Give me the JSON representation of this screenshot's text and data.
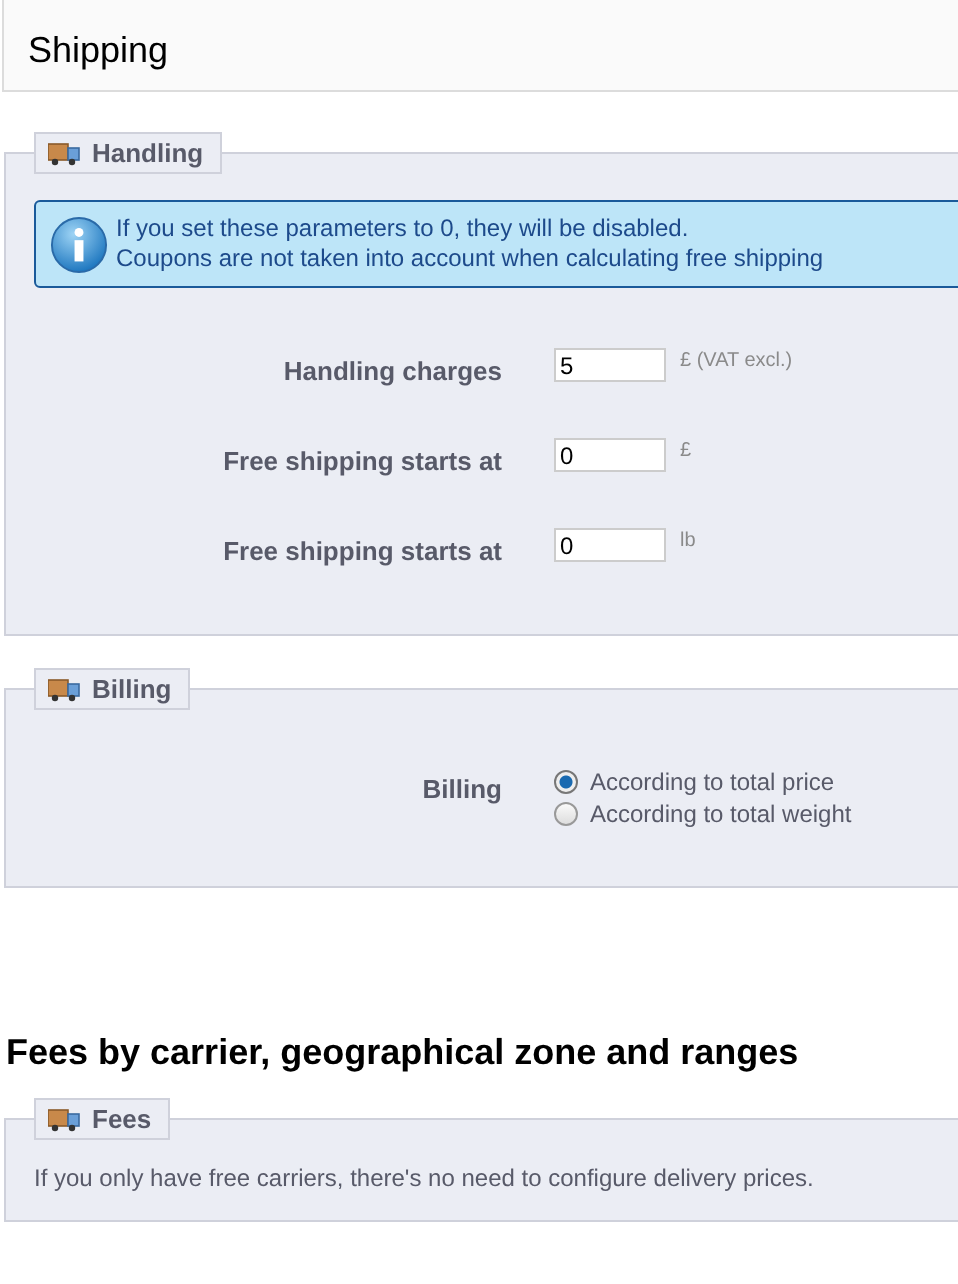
{
  "page_title": "Shipping",
  "handling": {
    "legend": "Handling",
    "info": [
      "If you set these parameters to 0, they will be disabled.",
      "Coupons are not taken into account when calculating free shipping"
    ],
    "fields": [
      {
        "label": "Handling charges",
        "value": "5",
        "unit": "£ (VAT excl.)"
      },
      {
        "label": "Free shipping starts at",
        "value": "0",
        "unit": "£"
      },
      {
        "label": "Free shipping starts at",
        "value": "0",
        "unit": "lb"
      }
    ]
  },
  "billing": {
    "legend": "Billing",
    "label": "Billing",
    "options": [
      {
        "label": "According to total price",
        "selected": true
      },
      {
        "label": "According to total weight",
        "selected": false
      }
    ]
  },
  "fees_heading": "Fees by carrier, geographical zone and ranges",
  "fees": {
    "legend": "Fees",
    "note": "If you only have free carriers, there's no need to configure delivery prices."
  }
}
